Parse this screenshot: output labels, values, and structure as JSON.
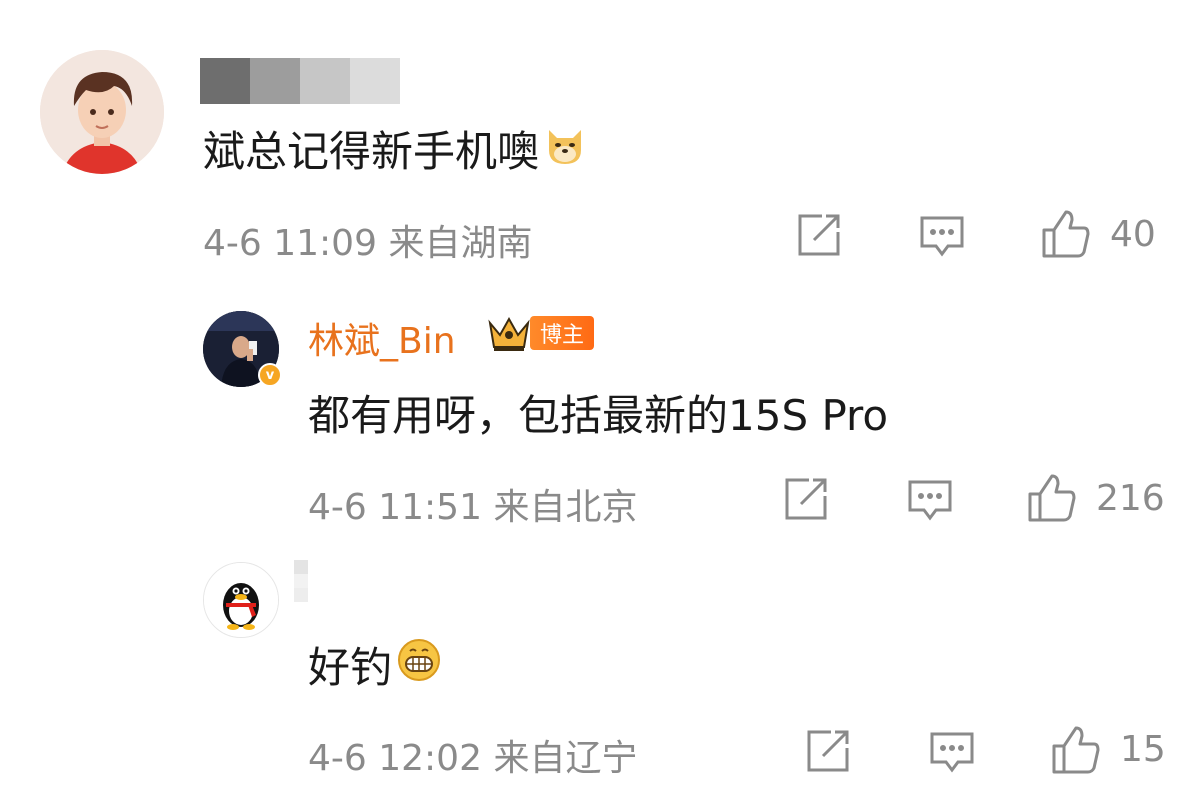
{
  "comments": [
    {
      "text": "斌总记得新手机噢",
      "emoji": "doge-emoji",
      "time": "4-6 11:09",
      "location": "来自湖南",
      "likes": "40"
    },
    {
      "name": "林斌_Bin",
      "badge": "博主",
      "text": "都有用呀，包括最新的15S Pro",
      "time": "4-6 11:51",
      "location": "来自北京",
      "likes": "216"
    },
    {
      "text": "好钓",
      "emoji": "grin-emoji",
      "time": "4-6 12:02",
      "location": "来自辽宁",
      "likes": "15"
    }
  ],
  "verified_mark": "v",
  "colors": {
    "name": "#e8721d",
    "meta": "#8a8a8a",
    "badge": "#ff7a1f",
    "verified": "#f6a623"
  }
}
